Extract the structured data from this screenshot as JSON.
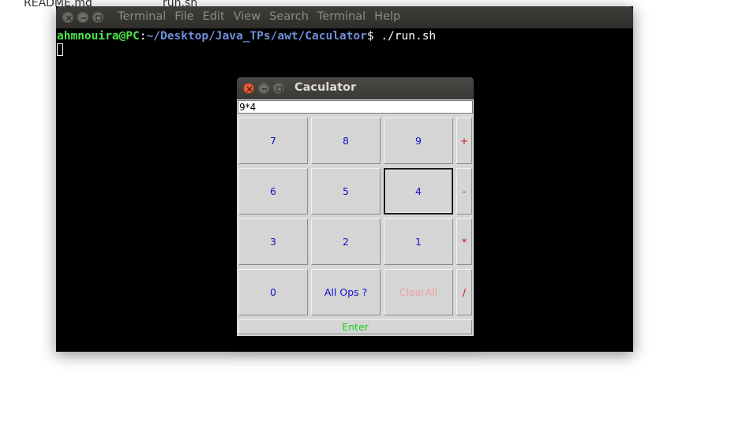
{
  "desktop": {
    "file1": "README.md",
    "file2": "run.sh"
  },
  "terminal": {
    "menu": [
      "Terminal",
      "File",
      "Edit",
      "View",
      "Search",
      "Terminal",
      "Help"
    ],
    "prompt_user": "ahmnouira@PC",
    "prompt_colon": ":",
    "prompt_path": "~/Desktop/Java_TPs/awt/Caculator",
    "prompt_symbol": "$",
    "command": " ./run.sh",
    "colors": {
      "user": "#4ee44e",
      "path": "#6f8fd8",
      "background": "#000000"
    }
  },
  "calculator": {
    "title": "Caculator",
    "display_value": "9*4",
    "keys": {
      "k7": "7",
      "k8": "8",
      "k9": "9",
      "k6": "6",
      "k5": "5",
      "k4": "4",
      "k3": "3",
      "k2": "2",
      "k1": "1",
      "k0": "0",
      "all_ops": "All Ops ?",
      "clear_all": "ClearAll",
      "plus": "+",
      "minus": "-",
      "multiply": "*",
      "divide": "/",
      "enter": "Enter"
    },
    "focused_key": "4",
    "colors": {
      "digit": "#1010c8",
      "operator": "#d01010",
      "clear": "#f0a0a0",
      "enter": "#18d018"
    }
  }
}
